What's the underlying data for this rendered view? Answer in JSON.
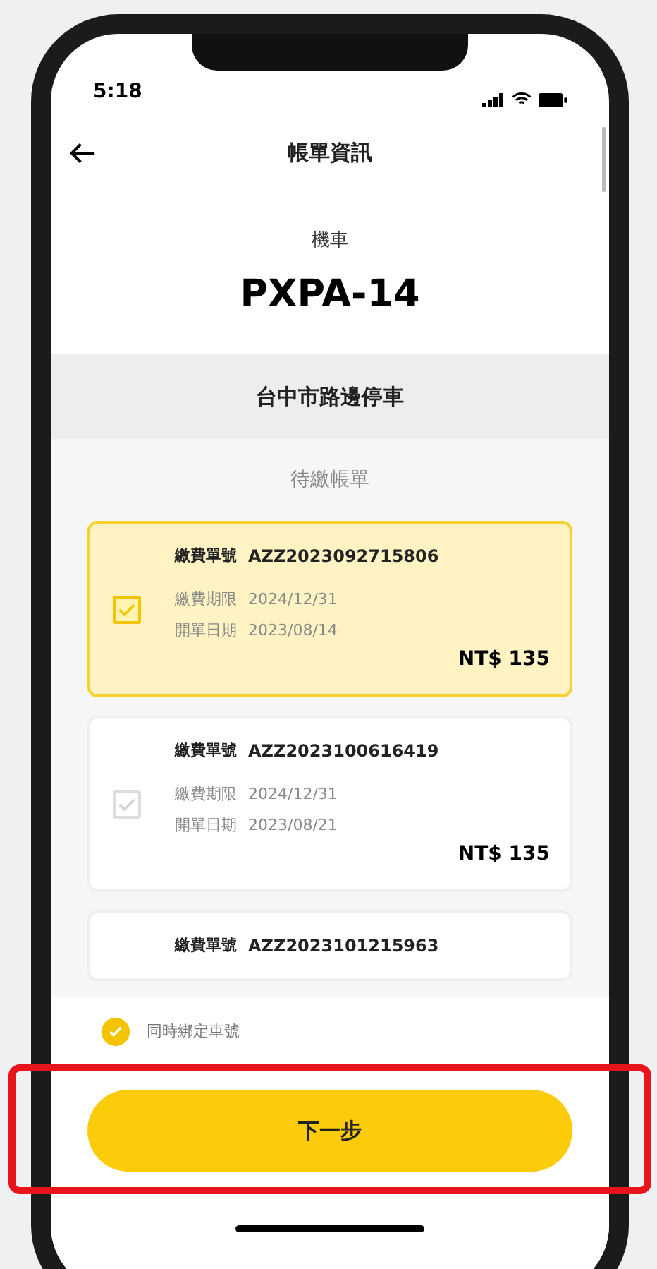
{
  "status_bar": {
    "time": "5:18"
  },
  "header": {
    "title": "帳單資訊"
  },
  "vehicle": {
    "type": "機車",
    "plate": "PXPA-14"
  },
  "section": {
    "title": "台中市路邊停車"
  },
  "bills_heading": "待繳帳單",
  "bills": [
    {
      "number_label": "繳費單號",
      "number": "AZZ2023092715806",
      "due_label": "繳費期限",
      "due": "2024/12/31",
      "issued_label": "開單日期",
      "issued": "2023/08/14",
      "amount": "NT$ 135",
      "selected": true
    },
    {
      "number_label": "繳費單號",
      "number": "AZZ2023100616419",
      "due_label": "繳費期限",
      "due": "2024/12/31",
      "issued_label": "開單日期",
      "issued": "2023/08/21",
      "amount": "NT$ 135",
      "selected": false
    },
    {
      "number_label": "繳費單號",
      "number": "AZZ2023101215963"
    }
  ],
  "bind_option": {
    "label": "同時綁定車號",
    "checked": true
  },
  "next_button": {
    "label": "下一步"
  },
  "annotation": {
    "highlight_next_button": true
  }
}
